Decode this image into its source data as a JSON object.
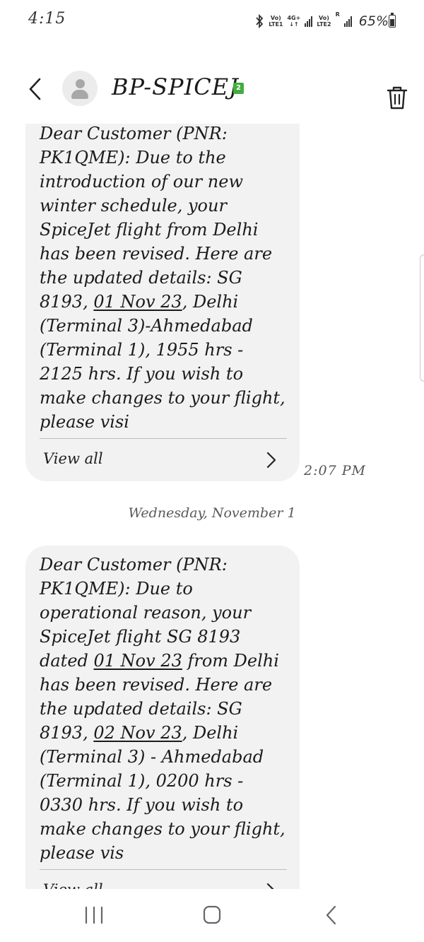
{
  "status_bar": {
    "time": "4:15",
    "sim1_label_top": "Vo)",
    "sim1_label_bottom": "LTE1",
    "net_label_top": "4G+",
    "net_label_bottom": "↓↑",
    "sim2_label_top": "Vo)",
    "sim2_label_bottom": "LTE2",
    "roaming": "R",
    "battery": "65%",
    "battery_level": 0.65,
    "icons": [
      "bluetooth-icon",
      "signal-icon",
      "battery-icon"
    ]
  },
  "header": {
    "contact_name": "BP-SPICEJ",
    "sim_badge": "2",
    "icons": [
      "back-icon",
      "avatar-icon",
      "trash-icon"
    ]
  },
  "messages": [
    {
      "text_parts": [
        "Dear Customer (PNR: PK1QME): Due to the introduction of our new winter schedule, your SpiceJet flight from Delhi has been revised. Here are the updated details: SG 8193, ",
        "01 Nov 23",
        ", Delhi (Terminal 3)-Ahmedabad (Terminal 1), 1955 hrs - 2125 hrs. If you wish to make changes to your flight, please visi"
      ],
      "view_all": "View all",
      "time": "2:07 PM"
    },
    {
      "text_parts": [
        "Dear Customer (PNR: PK1QME): Due to operational reason, your SpiceJet flight SG 8193 dated ",
        "01 Nov 23",
        " from Delhi has been revised. Here are the updated details: SG 8193, ",
        "02 Nov 23",
        ", Delhi (Terminal 3) - Ahmedabad (Terminal 1), 0200 hrs - 0330 hrs. If you wish to make changes to your flight, please vis"
      ],
      "view_all": "View all"
    }
  ],
  "date_separator": "Wednesday, November 1",
  "nav_bar": {
    "icons": [
      "recent-apps-icon",
      "home-icon",
      "back-icon"
    ]
  },
  "colors": {
    "bubble": "#f2f2f2",
    "sim_badge": "#3fae3f",
    "background": "#ffffff"
  }
}
